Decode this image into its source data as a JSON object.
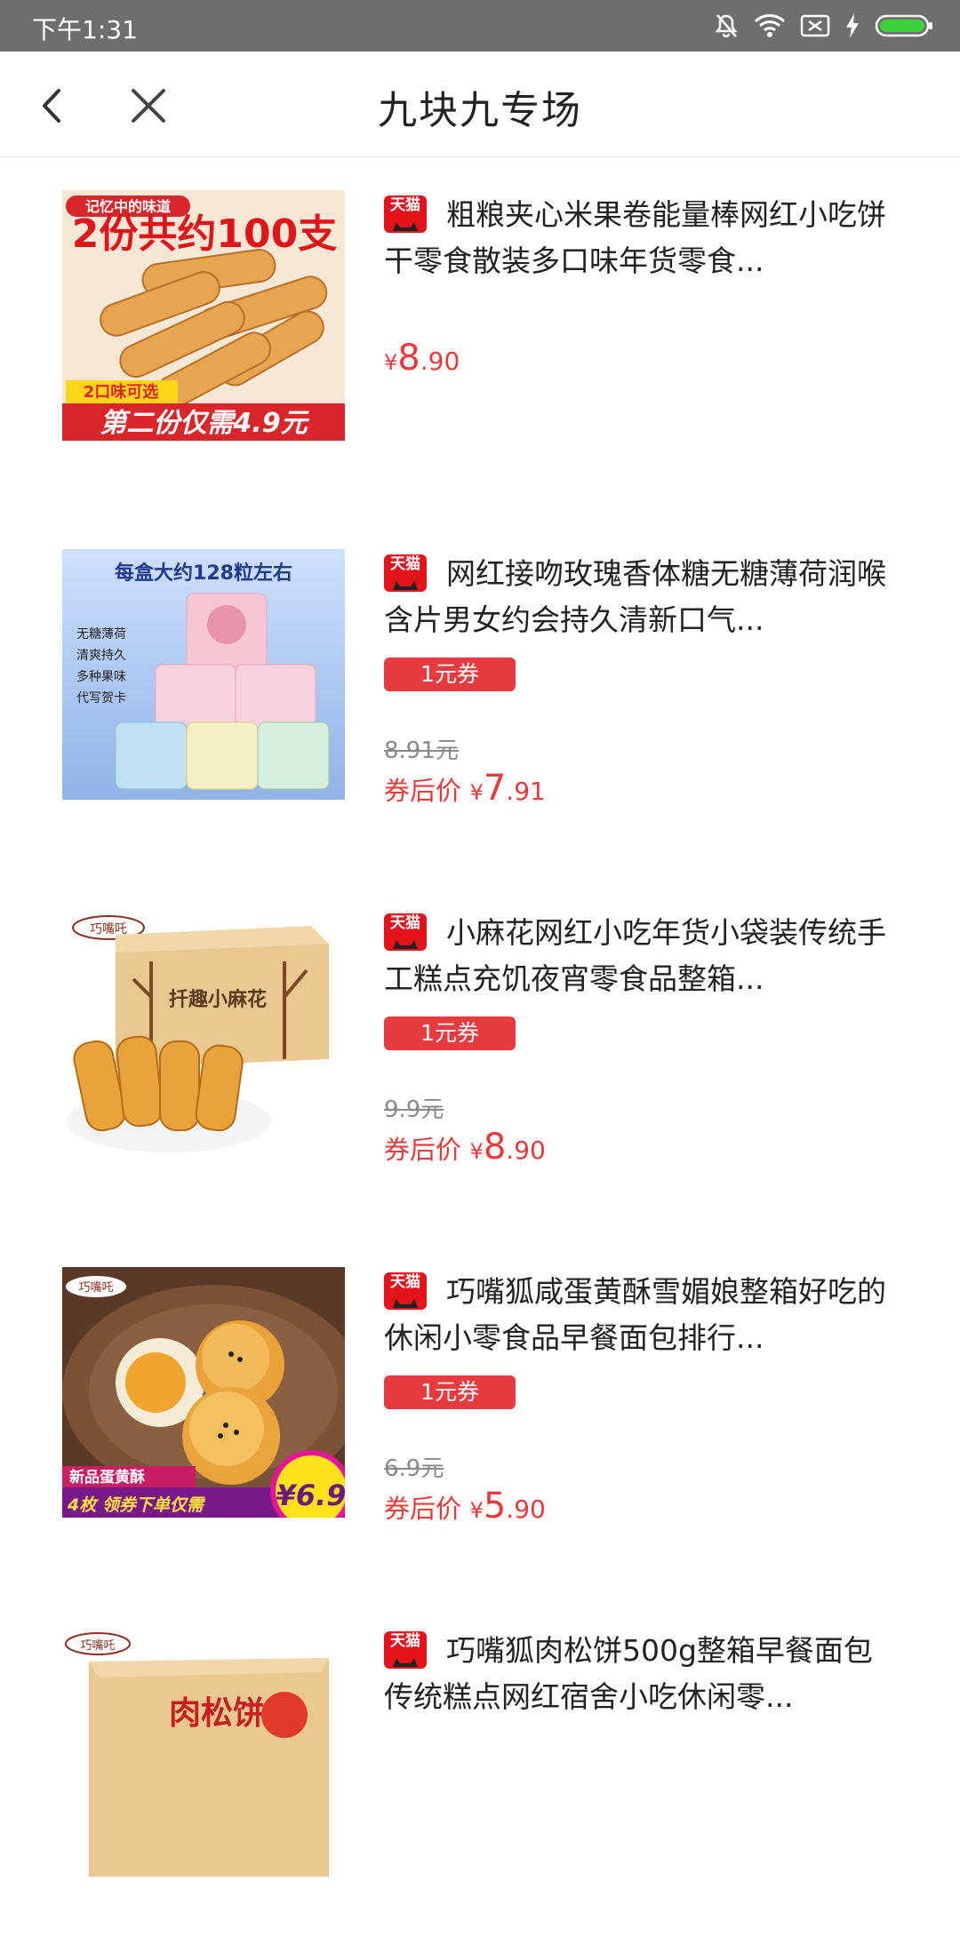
{
  "status_bar": {
    "time": "下午1:31"
  },
  "header": {
    "title": "九块九专场"
  },
  "products": [
    {
      "platform": "天猫",
      "name": "粗粮夹心米果卷能量棒网红小吃饼干零食散装多口味年货零食...",
      "coupon": "",
      "original_price": "",
      "price_label": "",
      "currency": "¥",
      "price_int": "8",
      "price_dec": ".90",
      "thumb": {
        "banner_top": "记忆中的味道",
        "banner_main": "2份共约100支",
        "tag": "2口味可选",
        "bottom": "第二份仅需4.9元"
      }
    },
    {
      "platform": "天猫",
      "name": "网红接吻玫瑰香体糖无糖薄荷润喉含片男女约会持久清新口气...",
      "coupon": "1元券",
      "original_price": "8.91元",
      "price_label": "券后价",
      "currency": "¥",
      "price_int": "7",
      "price_dec": ".91",
      "thumb": {
        "headline": "每盒大约128粒左右",
        "checks": [
          "无糖薄荷",
          "清爽持久",
          "多种果味",
          "代写贺卡"
        ]
      }
    },
    {
      "platform": "天猫",
      "name": "小麻花网红小吃年货小袋装传统手工糕点充饥夜宵零食品整箱...",
      "coupon": "1元券",
      "original_price": "9.9元",
      "price_label": "券后价",
      "currency": "¥",
      "price_int": "8",
      "price_dec": ".90",
      "thumb": {
        "brand": "巧嘴吒",
        "box_label": "扦趣小麻花"
      }
    },
    {
      "platform": "天猫",
      "name": "巧嘴狐咸蛋黄酥雪媚娘整箱好吃的休闲小零食品早餐面包排行...",
      "coupon": "1元券",
      "original_price": "6.9元",
      "price_label": "券后价",
      "currency": "¥",
      "price_int": "5",
      "price_dec": ".90",
      "thumb": {
        "brand": "巧嘴吒",
        "tag": "新品蛋黄酥",
        "bottom": "4枚 领券下单仅需",
        "badge": "¥6.9"
      }
    },
    {
      "platform": "天猫",
      "name": "巧嘴狐肉松饼500g整箱早餐面包传统糕点网红宿舍小吃休闲零...",
      "coupon": "",
      "original_price": "",
      "price_label": "",
      "currency": "",
      "price_int": "",
      "price_dec": "",
      "thumb": {
        "brand": "巧嘴吒",
        "box_label": "肉松饼"
      }
    }
  ]
}
